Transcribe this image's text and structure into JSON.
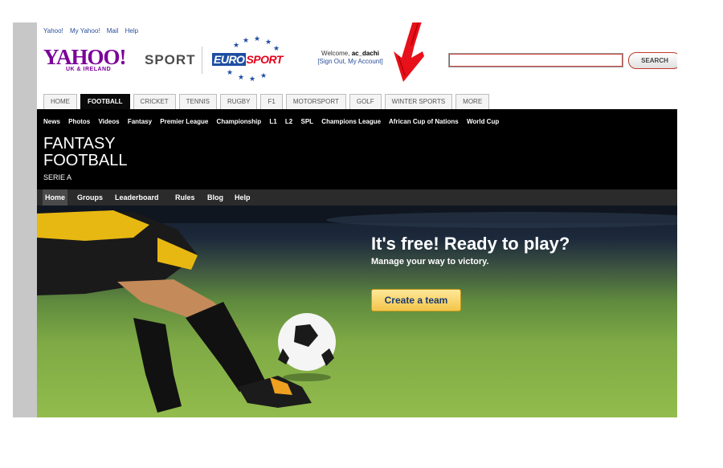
{
  "top_links": [
    "Yahoo!",
    "My Yahoo!",
    "Mail",
    "Help"
  ],
  "logo": {
    "yahoo": "YAHOO!",
    "region": "UK & IRELAND",
    "sport": "SPORT",
    "eurosport_a": "EURO",
    "eurosport_b": "SPORT"
  },
  "welcome": {
    "prefix": "Welcome, ",
    "user": "ac_dachi",
    "links": "[Sign Out, My Account]"
  },
  "search": {
    "value": "",
    "button": "SEARCH"
  },
  "tabs": [
    {
      "label": "HOME"
    },
    {
      "label": "FOOTBALL",
      "active": true
    },
    {
      "label": "CRICKET"
    },
    {
      "label": "TENNIS"
    },
    {
      "label": "RUGBY"
    },
    {
      "label": "F1"
    },
    {
      "label": "MOTORSPORT"
    },
    {
      "label": "GOLF"
    },
    {
      "label": "WINTER SPORTS"
    },
    {
      "label": "MORE"
    }
  ],
  "subnav": [
    "News",
    "Photos",
    "Videos",
    "Fantasy",
    "Premier League",
    "Championship",
    "L1",
    "L2",
    "SPL",
    "Champions League",
    "African Cup of Nations",
    "World Cup"
  ],
  "section": {
    "title_line1": "FANTASY",
    "title_line2": "FOOTBALL",
    "subtitle": "SERIE A"
  },
  "game_nav": [
    "Home",
    "Groups",
    "Leaderboard",
    "Rules",
    "Blog",
    "Help"
  ],
  "hero": {
    "title": "It's free! Ready to play?",
    "subtitle": "Manage your way to victory.",
    "cta": "Create a team"
  },
  "colors": {
    "yahoo_purple": "#7b0099",
    "eurosport_blue": "#1e4ea1",
    "eurosport_red": "#e5001a",
    "arrow_red": "#e8101a",
    "cta_yellow": "#f3c54a"
  }
}
